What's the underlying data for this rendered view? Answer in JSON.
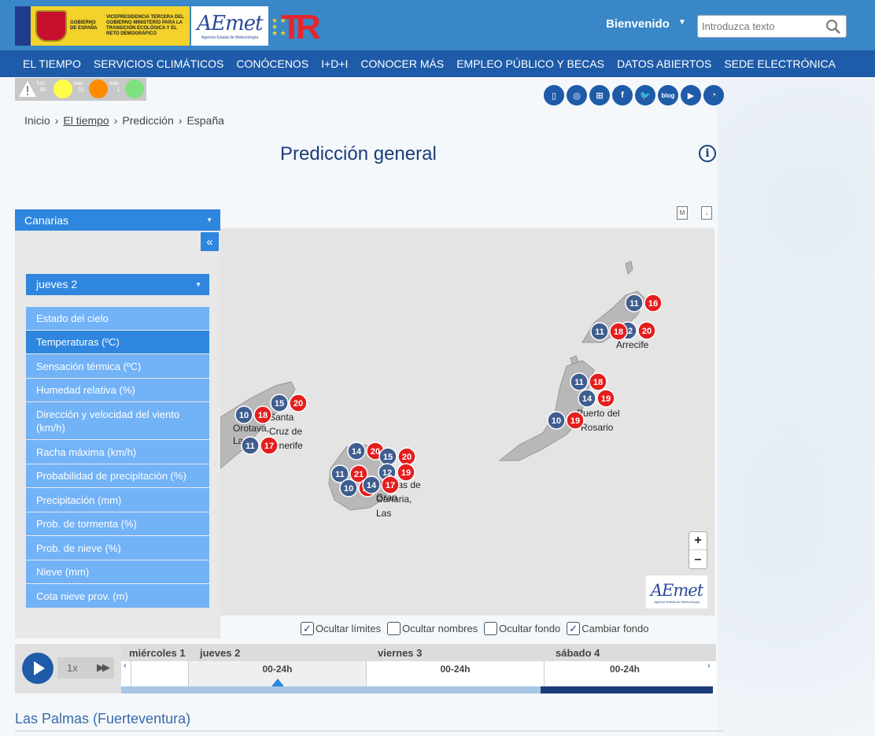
{
  "header": {
    "gov_logo_text": "GOBIERNO DE ESPAÑA",
    "ministry_text": "VICEPRESIDENCIA TERCERA DEL GOBIERNO MINISTERIO PARA LA TRANSICIÓN ECOLÓGICA Y EL RETO DEMOGRÁFICO",
    "aemet_logo": "AEmet",
    "aemet_subtitle": "Agencia Estatal de Meteorología",
    "welcome": "Bienvenido",
    "search_placeholder": "Introduzca texto"
  },
  "nav": [
    "EL TIEMPO",
    "SERVICIOS CLIMÁTICOS",
    "CONÓCENOS",
    "I+D+I",
    "CONOCER MÁS",
    "EMPLEO PÚBLICO Y BECAS",
    "DATOS ABIERTOS",
    "SEDE ELECTRÓNICA"
  ],
  "warnings": {
    "days": [
      {
        "name": "lun.",
        "num": "30",
        "color": "#ffff4a"
      },
      {
        "name": "mar.",
        "num": "31",
        "color": "#ff8c00"
      },
      {
        "name": "mié.",
        "num": "1",
        "color": "#7ee07e"
      }
    ]
  },
  "social": [
    "mobile-icon",
    "app-icon",
    "sitemap-icon",
    "facebook-icon",
    "twitter-icon",
    "blog-icon",
    "youtube-icon",
    "rss-icon"
  ],
  "social_labels": {
    "facebook": "f",
    "blog": "blog"
  },
  "breadcrumb": [
    "Inicio",
    "El tiempo",
    "Predicción",
    "España"
  ],
  "page_title": "Predicción general",
  "region": "Canarias",
  "day_selected": "jueves 2",
  "variables": [
    "Estado del cielo",
    "Temperaturas (ºC)",
    "Sensación térmica (ºC)",
    "Humedad relativa (%)",
    "Dirección y velocidad del viento (km/h)",
    "Racha máxima (km/h)",
    "Probabilidad de precipitación (%)",
    "Precipitación (mm)",
    "Prob. de tormenta (%)",
    "Prob. de nieve (%)",
    "Nieve (mm)",
    "Cota nieve prov. (m)"
  ],
  "active_variable": "Temperaturas (ºC)",
  "map": {
    "cities": [
      "Arrecife",
      "Puerto del Rosario",
      "Santa Cruz de Tenerife",
      "Orotava, La",
      "Palmas de Gran Canaria, Las"
    ],
    "city_labels": [
      "Arrecife",
      "Puerto del",
      "Rosario",
      "Santa",
      "Cruz de",
      "Tenerife",
      "Orotava,",
      "La",
      "Palmas de",
      "Gran",
      "Canaria,",
      "Las"
    ],
    "temps": [
      {
        "min": 11,
        "max": 16
      },
      {
        "min": 11,
        "max": 18
      },
      {
        "min": 12,
        "max": 20
      },
      {
        "min": 11,
        "max": 18
      },
      {
        "min": 14,
        "max": 19
      },
      {
        "min": 10,
        "max": 19
      },
      {
        "min": 15,
        "max": 20
      },
      {
        "min": 10,
        "max": 18
      },
      {
        "min": 11,
        "max": 17
      },
      {
        "min": 14,
        "max": 20
      },
      {
        "min": 15,
        "max": 20
      },
      {
        "min": 11,
        "max": 21
      },
      {
        "min": 12,
        "max": 19
      },
      {
        "min": 10,
        "max": 20
      },
      {
        "min": 14,
        "max": 17
      }
    ],
    "zoom_in": "+",
    "zoom_out": "–"
  },
  "checkboxes": [
    {
      "label": "Ocultar límites",
      "checked": true
    },
    {
      "label": "Ocultar nombres",
      "checked": false
    },
    {
      "label": "Ocultar fondo",
      "checked": false
    },
    {
      "label": "Cambiar fondo",
      "checked": true
    }
  ],
  "timeline": {
    "speed": "1x",
    "days": [
      "miércoles 1",
      "jueves 2",
      "viernes 3",
      "sábado 4"
    ],
    "slots": [
      "00-24h",
      "00-24h",
      "00-24h"
    ]
  },
  "section_title": "Las Palmas (Fuerteventura)",
  "colors": {
    "min_badge": "#3f5d8f",
    "max_badge": "#e41e1e",
    "accent": "#2e86de",
    "nav": "#1e5ba8"
  }
}
